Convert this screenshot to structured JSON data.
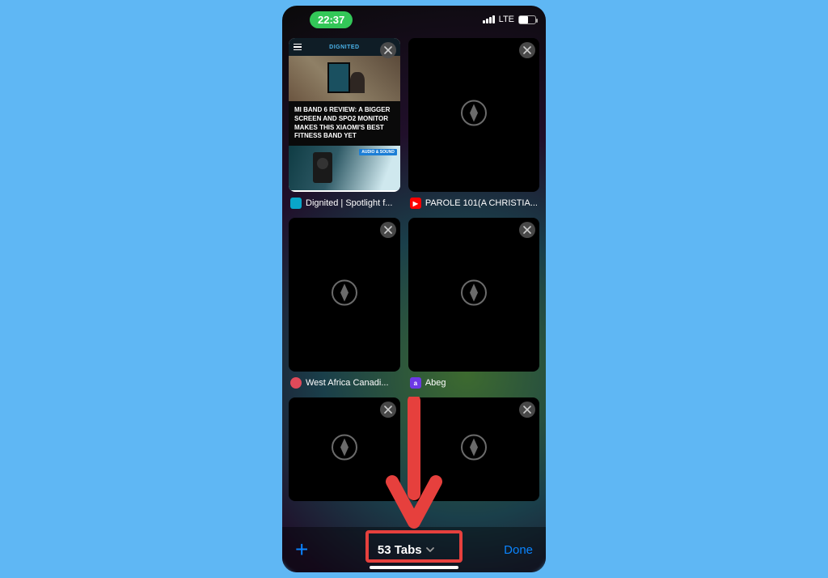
{
  "status": {
    "time": "22:37",
    "network_label": "LTE"
  },
  "tabs": [
    {
      "title": "Dignited | Spotlight f...",
      "headline": "MI BAND 6 REVIEW: A BIGGER SCREEN AND SPO2 MONITOR MAKES THIS XIAOMI'S BEST FITNESS BAND YET",
      "brand": "DIGNITED",
      "audio_badge": "AUDIO & SOUND",
      "favicon_class": "fav-dignited"
    },
    {
      "title": "PAROLE 101(A CHRISTIA...",
      "favicon_class": "fav-youtube",
      "favicon_glyph": "▶"
    },
    {
      "title": "West Africa Canadi...",
      "favicon_class": "fav-wa"
    },
    {
      "title": "Abeg",
      "favicon_class": "fav-abeg",
      "favicon_glyph": "a"
    },
    {
      "title": ""
    },
    {
      "title": ""
    }
  ],
  "toolbar": {
    "tabs_label": "53 Tabs",
    "done_label": "Done"
  }
}
